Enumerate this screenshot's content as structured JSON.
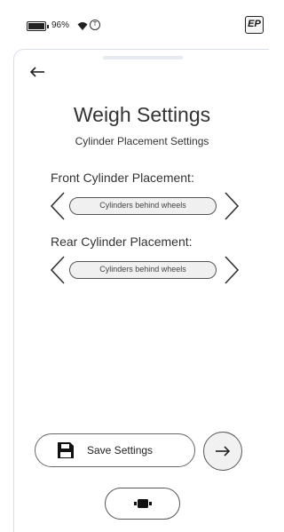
{
  "status_bar": {
    "battery_percent": "96%",
    "circle_icon_glyph": "T",
    "logo_text": "EP"
  },
  "page": {
    "title": "Weigh Settings",
    "subtitle": "Cylinder Placement Settings"
  },
  "front": {
    "label": "Front Cylinder Placement:",
    "value": "Cylinders behind wheels"
  },
  "rear": {
    "label": "Rear Cylinder Placement:",
    "value": "Cylinders behind wheels"
  },
  "actions": {
    "save_label": "Save Settings"
  },
  "icons": {
    "back": "arrow-left-icon",
    "prev": "chevron-left-icon",
    "next": "chevron-right-icon",
    "save": "floppy-disk-icon",
    "continue": "arrow-right-icon",
    "bottom": "rollers-icon"
  }
}
